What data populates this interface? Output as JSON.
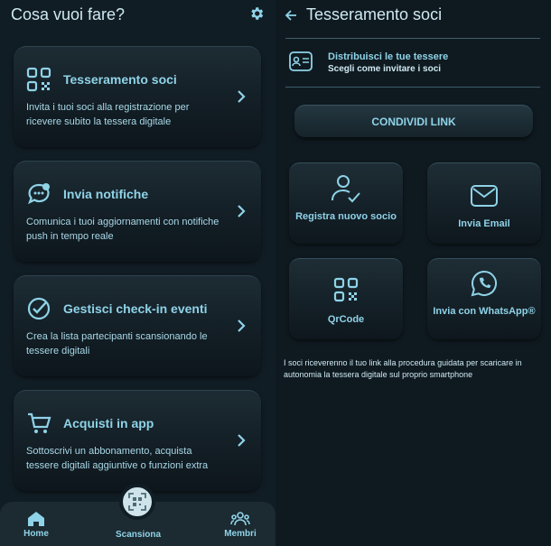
{
  "left": {
    "header": {
      "title": "Cosa vuoi fare?",
      "settings_icon": "gear-icon"
    },
    "cards": [
      {
        "title": "Tesseramento soci",
        "desc": "Invita i tuoi soci alla registrazione per ricevere subito la tessera digitale",
        "icon": "qr-icon"
      },
      {
        "title": "Invia notifiche",
        "desc": "Comunica i tuoi aggiornamenti con notifiche push in tempo reale",
        "icon": "chat-bubble-icon"
      },
      {
        "title": "Gestisci check-in eventi",
        "desc": "Crea la lista partecipanti scansionando le tessere digitali",
        "icon": "check-circle-icon"
      },
      {
        "title": "Acquisti in app",
        "desc": "Sottoscrivi un abbonamento, acquista tessere digitali aggiuntive o funzioni extra",
        "icon": "cart-icon"
      }
    ],
    "nav": {
      "home": "Home",
      "scan": "Scansiona",
      "members": "Membri"
    }
  },
  "right": {
    "header": {
      "title": "Tesseramento soci"
    },
    "info": {
      "line1": "Distribuisci le tue tessere",
      "line2": "Scegli come invitare i soci"
    },
    "share_button": "CONDIVIDI LINK",
    "tiles": [
      {
        "label": "Registra nuovo socio",
        "icon": "user-check-icon"
      },
      {
        "label": "Invia Email",
        "icon": "mail-icon"
      },
      {
        "label": "QrCode",
        "icon": "qr-icon"
      },
      {
        "label": "Invia con WhatsApp®",
        "icon": "whatsapp-icon"
      }
    ],
    "note": "I soci riceverenno il tuo link alla procedura guidata per scaricare in autonomia la tessera digitale sul proprio smartphone"
  },
  "colors": {
    "accent": "#8fd3e8",
    "background": "#111d24",
    "card": "#1d2c34"
  }
}
